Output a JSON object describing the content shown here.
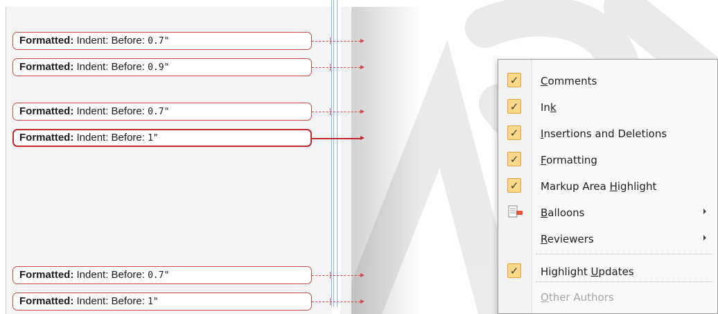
{
  "balloons": [
    {
      "bold": "Formatted:",
      "text": "Indent: Before:",
      "value": "0.7\"",
      "selected": false
    },
    {
      "bold": "Formatted:",
      "text": "Indent: Before:",
      "value": "0.9\"",
      "selected": false
    },
    {
      "bold": "Formatted:",
      "text": "Indent: Before:",
      "value": "0.7\"",
      "selected": false
    },
    {
      "bold": "Formatted:",
      "text": "Indent: Before:",
      "value": "1\"",
      "selected": true
    },
    {
      "bold": "Formatted:",
      "text": "Indent: Before:",
      "value": "0.7\"",
      "selected": false
    },
    {
      "bold": "Formatted:",
      "text": "Indent: Before:",
      "value": "1\"",
      "selected": false
    }
  ],
  "menu": {
    "items": [
      {
        "pre": "",
        "key": "C",
        "post": "omments",
        "checked": true,
        "icon": "check-icon"
      },
      {
        "pre": "In",
        "key": "k",
        "post": "",
        "checked": true,
        "icon": "check-icon"
      },
      {
        "pre": "",
        "key": "I",
        "post": "nsertions and Deletions",
        "checked": true,
        "icon": "check-icon"
      },
      {
        "pre": "",
        "key": "F",
        "post": "ormatting",
        "checked": true,
        "icon": "check-icon"
      },
      {
        "pre": "Markup Area ",
        "key": "H",
        "post": "ighlight",
        "checked": true,
        "icon": "check-icon"
      },
      {
        "pre": "",
        "key": "B",
        "post": "alloons",
        "checked": false,
        "icon": "balloons-icon",
        "submenu": true
      },
      {
        "pre": "",
        "key": "R",
        "post": "eviewers",
        "checked": false,
        "icon": "",
        "submenu": true
      },
      {
        "pre": "Highlight ",
        "key": "U",
        "post": "pdates",
        "checked": true,
        "icon": "check-icon"
      },
      {
        "pre": "",
        "key": "O",
        "post": "ther Authors",
        "checked": false,
        "icon": "",
        "disabled": true
      }
    ],
    "check_glyph": "✓"
  },
  "colors": {
    "balloon_border": "#d14a4a",
    "balloon_selected": "#c0282d",
    "check_bg": "#fbd88a",
    "check_border": "#e3a43b"
  }
}
